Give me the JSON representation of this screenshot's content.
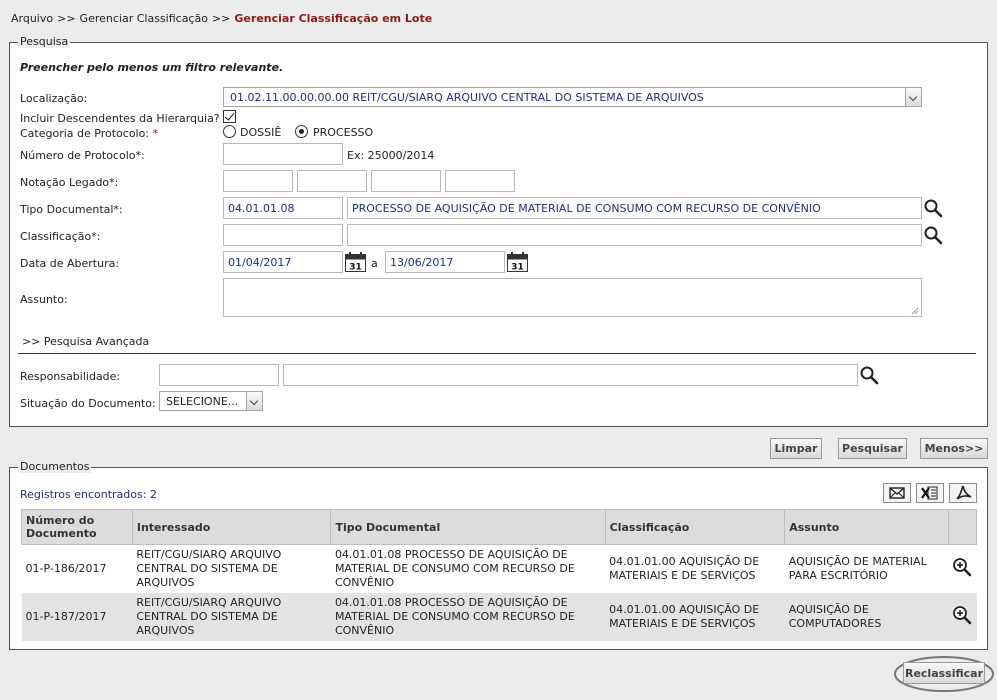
{
  "breadcrumb": {
    "items": [
      "Arquivo",
      "Gerenciar Classificação"
    ],
    "separator": ">>",
    "current": "Gerenciar Classificação em Lote"
  },
  "pesquisa": {
    "legend": "Pesquisa",
    "hint": "Preencher pelo menos um filtro relevante.",
    "localizacao": {
      "label": "Localização:",
      "value": "01.02.11.00.00.00.00 REIT/CGU/SIARQ ARQUIVO CENTRAL DO SISTEMA DE ARQUIVOS"
    },
    "incluir": {
      "label": "Incluir Descendentes da Hierarquia?",
      "checked": true
    },
    "categoria": {
      "label": "Categoria de Protocolo:",
      "required_mark": "*",
      "options": [
        "DOSSIÊ",
        "PROCESSO"
      ],
      "selected": "PROCESSO"
    },
    "numero": {
      "label": "Número de Protocolo*:",
      "value": "",
      "example": "Ex: 25000/2014"
    },
    "notacao": {
      "label": "Notação Legado*:"
    },
    "tipo": {
      "label": "Tipo Documental*:",
      "code": "04.01.01.08",
      "desc": "PROCESSO DE AQUISIÇÃO DE MATERIAL DE CONSUMO COM RECURSO DE CONVÊNIO"
    },
    "classificacao": {
      "label": "Classificação*:",
      "code": "",
      "desc": ""
    },
    "data": {
      "label": "Data de Abertura:",
      "from": "01/04/2017",
      "to_label": "a",
      "to": "13/06/2017",
      "calendar_day": "31"
    },
    "assunto": {
      "label": "Assunto:",
      "value": ""
    },
    "avancada": {
      "label": ">> Pesquisa Avançada"
    },
    "responsabilidade": {
      "label": "Responsabilidade:"
    },
    "situacao": {
      "label": "Situação do Documento:",
      "value": "SELECIONE..."
    }
  },
  "actions": {
    "limpar": "Limpar",
    "pesquisar": "Pesquisar",
    "menos": "Menos>>"
  },
  "documentos": {
    "legend": "Documentos",
    "count_label": "Registros encontrados: 2",
    "columns": [
      "Número do Documento",
      "Interessado",
      "Tipo Documental",
      "Classificação",
      "Assunto"
    ],
    "rows": [
      {
        "numero": "01-P-186/2017",
        "interessado": "REIT/CGU/SIARQ ARQUIVO CENTRAL DO SISTEMA DE ARQUIVOS",
        "tipo": "04.01.01.08 PROCESSO DE AQUISIÇÃO DE MATERIAL DE CONSUMO COM RECURSO DE CONVÊNIO",
        "classificacao": "04.01.01.00 AQUISIÇÃO DE MATERIAIS E DE SERVIÇOS",
        "assunto": "AQUISIÇÃO DE MATERIAL PARA ESCRITÓRIO"
      },
      {
        "numero": "01-P-187/2017",
        "interessado": "REIT/CGU/SIARQ ARQUIVO CENTRAL DO SISTEMA DE ARQUIVOS",
        "tipo": "04.01.01.08 PROCESSO DE AQUISIÇÃO DE MATERIAL DE CONSUMO COM RECURSO DE CONVÊNIO",
        "classificacao": "04.01.01.00 AQUISIÇÃO DE MATERIAIS E DE SERVIÇOS",
        "assunto": "AQUISIÇÃO DE COMPUTADORES"
      }
    ],
    "toolbar_icons": [
      "email-icon",
      "excel-icon",
      "pdf-icon"
    ],
    "row_icon": "zoom-in-icon"
  },
  "reclassificar": "Reclassificar",
  "colors": {
    "accent": "#8b1a1a",
    "value_text": "#1a3470",
    "panel_bg": "#ececec",
    "row_alt": "#e3e3e3"
  }
}
